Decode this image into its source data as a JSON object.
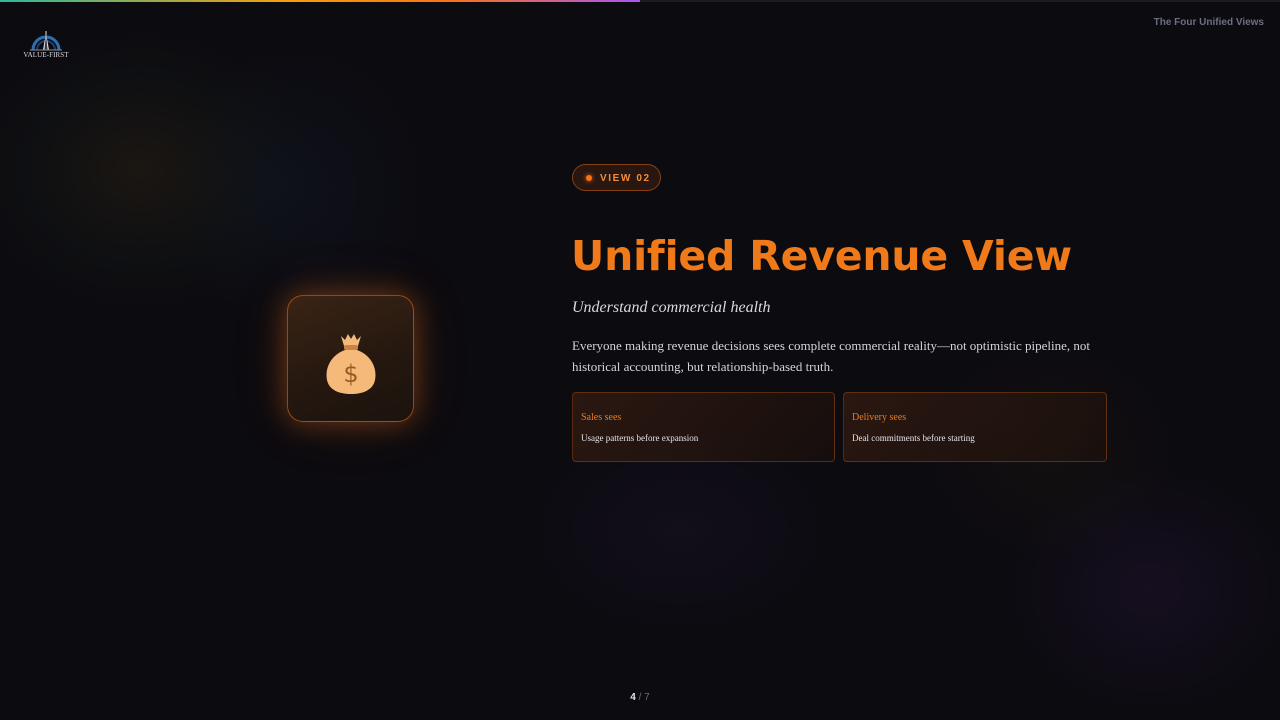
{
  "brand": {
    "logo_text": "VALUE-FIRST",
    "accent": "#f07a1a"
  },
  "header": {
    "section_label": "The Four Unified Views",
    "progress": 0.5
  },
  "slide": {
    "badge": "VIEW 02",
    "title": "Unified Revenue View",
    "subtitle": "Understand commercial health",
    "body": "Everyone making revenue decisions sees complete commercial reality—not optimistic pipeline, not historical accounting, but relationship-based truth.",
    "icon": "money-bag-icon",
    "cards": [
      {
        "title": "Sales sees",
        "body": "Usage patterns before expansion"
      },
      {
        "title": "Delivery sees",
        "body": "Deal commitments before starting"
      }
    ]
  },
  "pager": {
    "current": "4",
    "separator": "/",
    "total": "7"
  }
}
